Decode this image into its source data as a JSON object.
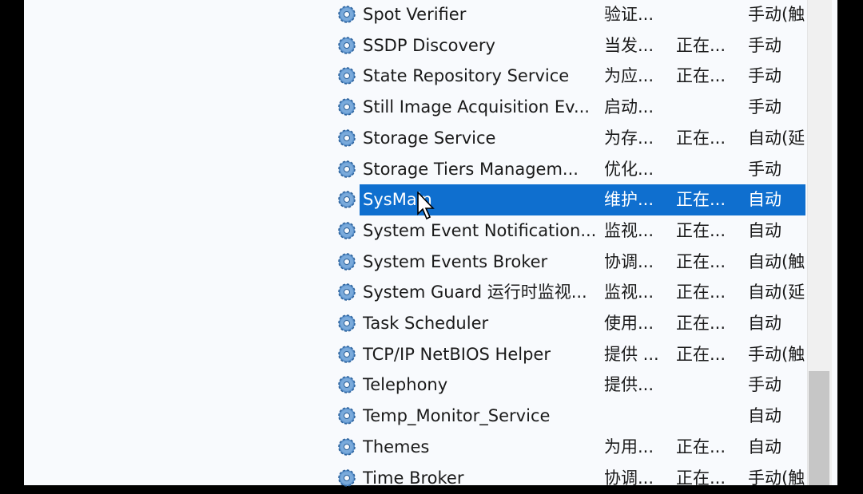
{
  "services": [
    {
      "name": "Spot Verifier",
      "description": "验证...",
      "status": "",
      "startup": "手动(触"
    },
    {
      "name": "SSDP Discovery",
      "description": "当发...",
      "status": "正在...",
      "startup": "手动"
    },
    {
      "name": "State Repository Service",
      "description": "为应...",
      "status": "正在...",
      "startup": "手动"
    },
    {
      "name": "Still Image Acquisition Ev...",
      "description": "启动...",
      "status": "",
      "startup": "手动"
    },
    {
      "name": "Storage Service",
      "description": "为存...",
      "status": "正在...",
      "startup": "自动(延"
    },
    {
      "name": "Storage Tiers Managem...",
      "description": "优化...",
      "status": "",
      "startup": "手动"
    },
    {
      "name": "SysMain",
      "description": "维护...",
      "status": "正在...",
      "startup": "自动",
      "selected": true
    },
    {
      "name": "System Event Notification...",
      "description": "监视...",
      "status": "正在...",
      "startup": "自动"
    },
    {
      "name": "System Events Broker",
      "description": "协调...",
      "status": "正在...",
      "startup": "自动(触"
    },
    {
      "name": "System Guard 运行时监视...",
      "description": "监视...",
      "status": "正在...",
      "startup": "自动(延"
    },
    {
      "name": "Task Scheduler",
      "description": "使用...",
      "status": "正在...",
      "startup": "自动"
    },
    {
      "name": "TCP/IP NetBIOS Helper",
      "description": "提供 ...",
      "status": "正在...",
      "startup": "手动(触"
    },
    {
      "name": "Telephony",
      "description": "提供...",
      "status": "",
      "startup": "手动"
    },
    {
      "name": "Temp_Monitor_Service",
      "description": "",
      "status": "",
      "startup": "自动"
    },
    {
      "name": "Themes",
      "description": "为用...",
      "status": "正在...",
      "startup": "自动"
    },
    {
      "name": "Time Broker",
      "description": "协调...",
      "status": "正在...",
      "startup": "手动(触"
    }
  ],
  "colors": {
    "selection": "#0f6fcf",
    "gear": "#3d7fc4"
  },
  "icon": "gear-icon"
}
